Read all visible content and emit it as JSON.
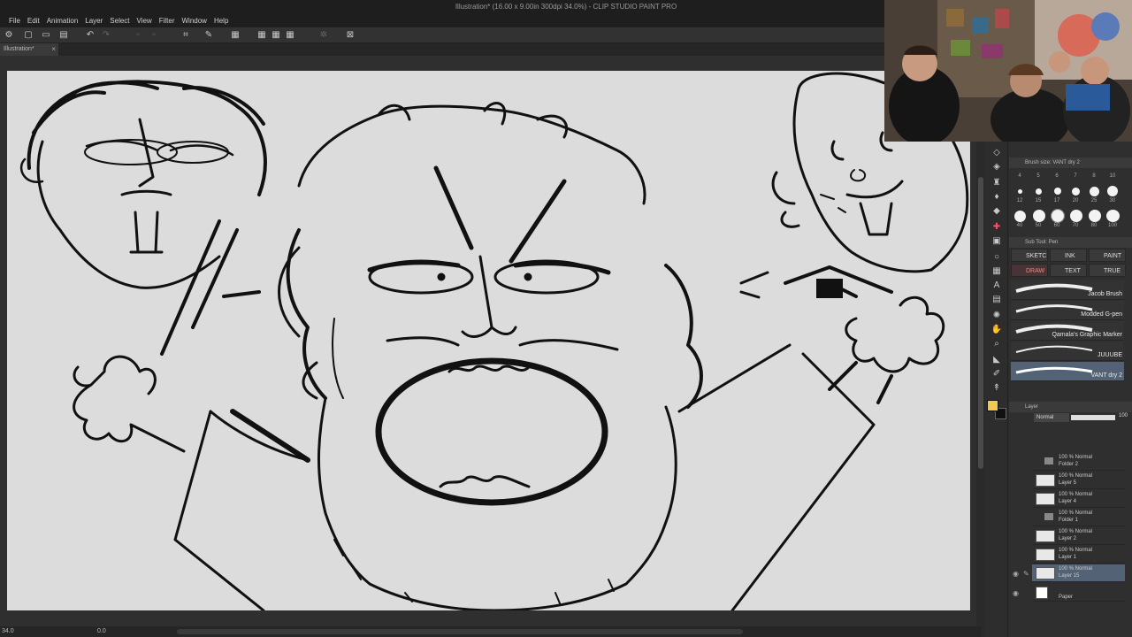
{
  "window": {
    "title": "Illustration* (16.00 x 9.00in 300dpi 34.0%) - CLIP STUDIO PAINT PRO"
  },
  "menu": [
    "File",
    "Edit",
    "Animation",
    "Layer",
    "Select",
    "View",
    "Filter",
    "Window",
    "Help"
  ],
  "document": {
    "tab_label": "Illustration*",
    "close_glyph": "×"
  },
  "status": {
    "zoom": "34.0",
    "rotation": "0.0"
  },
  "brush_size": {
    "header": "Brush size: VANT dry 2",
    "sizes": [
      [
        "4",
        "5",
        "6",
        "7",
        "8",
        "10"
      ],
      [
        "12",
        "15",
        "17",
        "20",
        "25",
        "30"
      ],
      [
        "40",
        "50",
        "60",
        "70",
        "80",
        "100"
      ]
    ],
    "selected": "60"
  },
  "sub_tool": {
    "header": "Sub Tool: Pen",
    "tabs": [
      "SKETC",
      "INK",
      "PAINT",
      "DRAW",
      "TEXT",
      "TRUE"
    ],
    "active_tab": "DRAW",
    "brushes": [
      "Jacob Brush",
      "Modded G-pen",
      "Qamala's Graphic Marker",
      "JUUUBE",
      "VANT dry 2"
    ],
    "selected_brush": "VANT dry 2"
  },
  "layer": {
    "header": "Layer",
    "blend_mode": "Normal",
    "opacity": "100",
    "rows": [
      {
        "opacity": "100 % Normal",
        "name": "Folder 2",
        "kind": "folder"
      },
      {
        "opacity": "100 % Normal",
        "name": "Layer 5",
        "kind": "raster"
      },
      {
        "opacity": "100 % Normal",
        "name": "Layer 4",
        "kind": "raster"
      },
      {
        "opacity": "100 % Normal",
        "name": "Folder 1",
        "kind": "folder"
      },
      {
        "opacity": "100 % Normal",
        "name": "Layer 2",
        "kind": "raster"
      },
      {
        "opacity": "100 % Normal",
        "name": "Layer 1",
        "kind": "raster"
      },
      {
        "opacity": "100 % Normal",
        "name": "Layer 15",
        "kind": "raster"
      },
      {
        "opacity": "",
        "name": "Paper",
        "kind": "paper"
      }
    ],
    "selected_layer": "Layer 15"
  },
  "colors": {
    "main": "#f2c94c",
    "sub": "#111111",
    "selection": "#536275",
    "canvas": "#dcdcdc"
  },
  "icons": {
    "toolbar": [
      "new-file-icon",
      "open-file-icon",
      "save-icon",
      "undo-icon",
      "redo-icon",
      "transform-icon",
      "pen-icon",
      "fill-icon",
      "grid-icon",
      "snap-icon",
      "settings-icon"
    ],
    "tools": [
      "eraser-icon",
      "pen-icon",
      "pencil-icon",
      "brush-icon",
      "airbrush-icon",
      "blend-icon",
      "fill-icon",
      "gradient-icon",
      "figure-icon",
      "frame-icon",
      "text-icon",
      "balloon-icon",
      "ruler-icon",
      "hand-icon",
      "zoom-icon",
      "eyedropper-icon",
      "selection-icon",
      "move-icon"
    ]
  }
}
